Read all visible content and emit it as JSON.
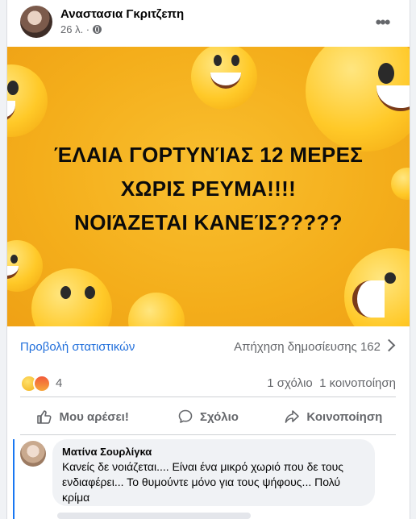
{
  "post": {
    "author": "Αναστασια Γκριτζεπη",
    "time": "26 λ. ·",
    "privacy_icon": "globe-icon",
    "more_icon": "more-options-icon"
  },
  "image": {
    "line1": "ΈΛΑΙΑ ΓΟΡΤΥΝΊΑΣ 12 ΜΕΡΕΣ",
    "line2": "ΧΩΡΙΣ ΡΕΥΜΑ!!!!",
    "line3": "ΝΟΙΆΖΕΤΑΙ ΚΑΝΕΊΣ?????"
  },
  "stats": {
    "insights_link": "Προβολή στατιστικών",
    "reach": "Απήχηση δημοσίευσης 162"
  },
  "reactions": {
    "count": "4",
    "comments": "1 σχόλιο",
    "shares": "1 κοινοποίηση",
    "types": [
      "sad",
      "angry"
    ]
  },
  "actions": {
    "like": "Μου αρέσει!",
    "comment": "Σχόλιο",
    "share": "Κοινοποίηση"
  },
  "comment": {
    "name": "Ματίνα Σουρλίγκα",
    "text": "Κανείς δε νοιάζεται.... Είναι ένα μικρό χωριό που δε τους ενδιαφέρει... Το θυμούντε μόνο για τους ψήφους... Πολύ κρίμα"
  },
  "colors": {
    "link_blue": "#216fdb",
    "image_bg": "#f4ae1b",
    "thread_line": "#1877f2"
  }
}
